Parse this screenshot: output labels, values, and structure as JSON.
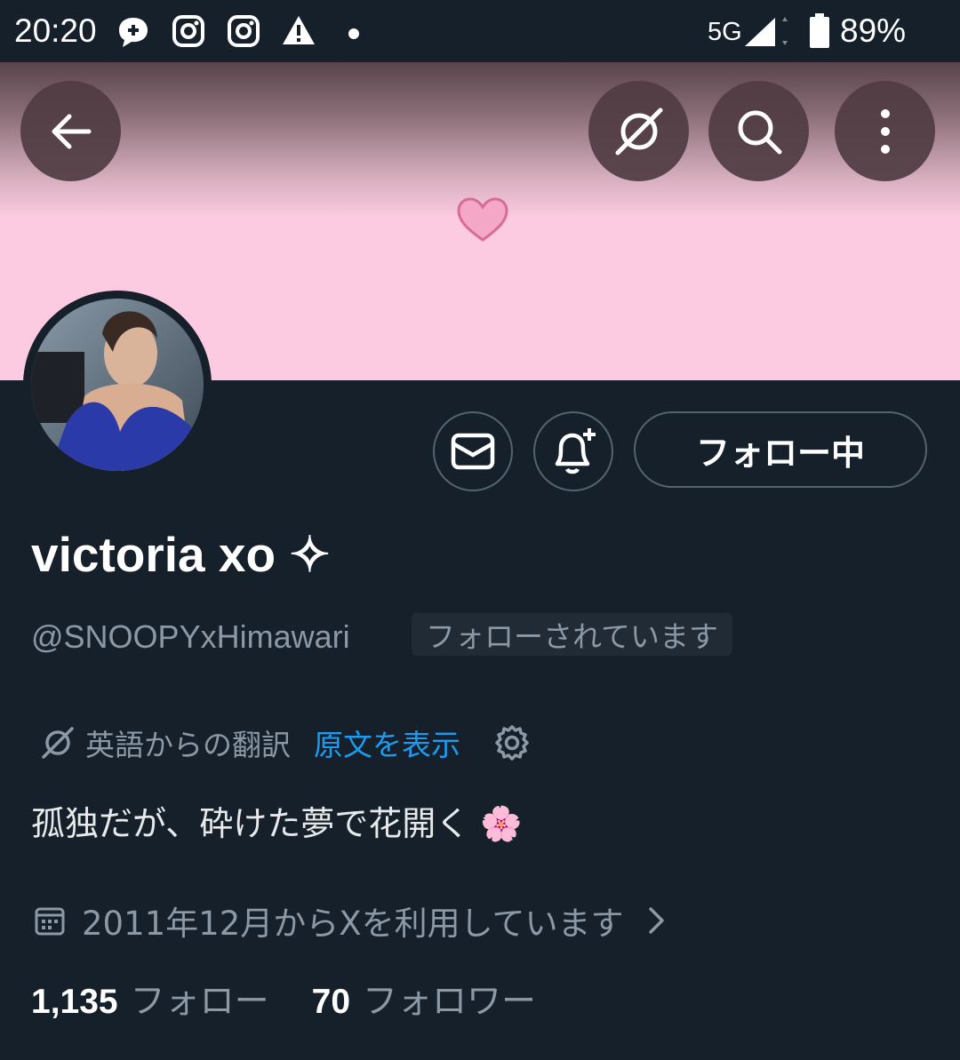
{
  "status_bar": {
    "time": "20:20",
    "network": "5G",
    "battery": "89%",
    "notification_icons": [
      "chat-plus-icon",
      "instagram-icon",
      "instagram-icon",
      "warning-icon",
      "dot-icon"
    ]
  },
  "banner": {
    "color": "#fccbe1",
    "emoji": "heart",
    "buttons": [
      "back-arrow-icon",
      "translate-icon",
      "search-icon",
      "more-vert-icon"
    ]
  },
  "actions": {
    "message_icon": "mail-icon",
    "notify_icon": "bell-plus-icon",
    "follow_label": "フォロー中"
  },
  "profile": {
    "display_name": "victoria xo ✧",
    "handle": "@SNOOPYxHimawari",
    "follows_you": "フォローされています",
    "translation_label": "英語からの翻訳",
    "show_original": "原文を表示",
    "bio": "孤独だが、砕けた夢で花開く 🌸",
    "joined": "2011年12月からXを利用しています"
  },
  "stats": {
    "following_count": "1,135",
    "following_label": "フォロー",
    "followers_count": "70",
    "followers_label": "フォロワー"
  },
  "colors": {
    "background": "#15202b",
    "accent_link": "#1d9bf0",
    "secondary_text": "#8b98a5"
  }
}
